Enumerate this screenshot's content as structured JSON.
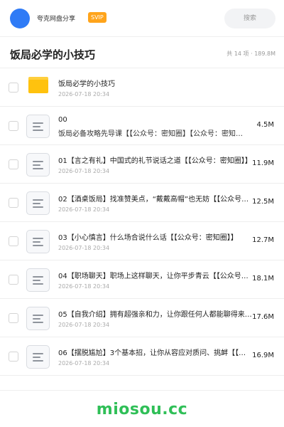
{
  "header": {
    "share_name": "夸克网盘分享",
    "badge": "SVIP",
    "search_label": "搜索"
  },
  "folder": {
    "title": "饭局必学的小技巧",
    "summary": "共 14 项 · 189.8M"
  },
  "files": [
    {
      "type": "folder",
      "name": "饭局必学的小技巧",
      "date": "2026-07-18 20:34",
      "size": ""
    },
    {
      "type": "file",
      "name": "00",
      "subname": "饭局必备攻略先导课【【公众号：密知圈】【公众号：密知圈】",
      "date": "",
      "size": "4.5M"
    },
    {
      "type": "file",
      "name": "01【言之有礼】中国式的礼节说话之道【【公众号：密知圈】】",
      "date": "2026-07-18 20:34",
      "size": "11.9M"
    },
    {
      "type": "file",
      "name": "02【酒桌饭局】找准赞美点，“戴戴高帽”也无妨【【公众号：密知圈】】",
      "date": "2026-07-18 20:34",
      "size": "12.5M"
    },
    {
      "type": "file",
      "name": "03【小心慎言】什么场合说什么话【【公众号：密知圈】】",
      "date": "2026-07-18 20:34",
      "size": "12.7M"
    },
    {
      "type": "file",
      "name": "04【职场聊天】职场上这样聊天，让你平步青云【【公众号：密知圈】】",
      "date": "2026-07-18 20:34",
      "size": "18.1M"
    },
    {
      "type": "file",
      "name": "05【自我介绍】拥有超强亲和力，让你跟任何人都能聊得来【【公众号：密知圈】】",
      "date": "2026-07-18 20:34",
      "size": "17.6M"
    },
    {
      "type": "file",
      "name": "06【摆脱尴尬】3个基本招，让你从容应对质问、挑衅【【公众号：密知圈】】",
      "date": "2026-07-18 20:34",
      "size": "16.9M"
    }
  ],
  "footer": {
    "watermark": "miosou.cc"
  },
  "colors": {
    "avatar": "#2f7bf6",
    "svip": "#ffa41b",
    "folder": "#ffc20e",
    "watermark": "#2fbf57"
  }
}
